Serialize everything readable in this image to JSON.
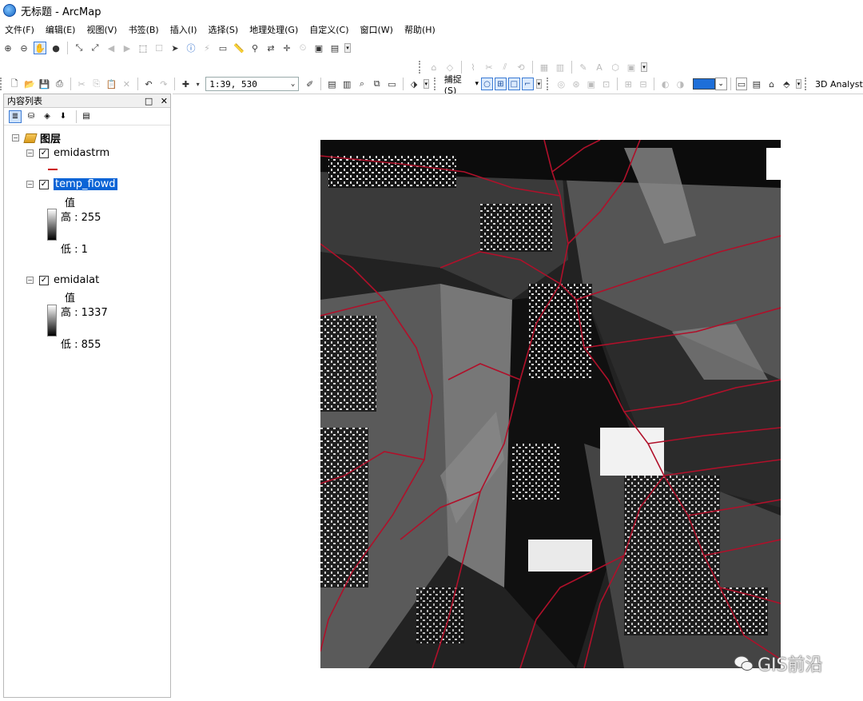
{
  "window": {
    "title": "无标题 - ArcMap"
  },
  "menu": [
    "文件(F)",
    "编辑(E)",
    "视图(V)",
    "书签(B)",
    "插入(I)",
    "选择(S)",
    "地理处理(G)",
    "自定义(C)",
    "窗口(W)",
    "帮助(H)"
  ],
  "toolbar": {
    "scale_value": "1:39, 530",
    "snap_label": "捕捉(S)",
    "snap_dropdown": "▾",
    "analyst_label": "3D Analyst"
  },
  "toc": {
    "title": "内容列表",
    "pin_icon": "□",
    "close_icon": "✕",
    "root_label": "图层",
    "layers": [
      {
        "name": "emidastrm",
        "checked": "☑"
      },
      {
        "name": "temp_flowd",
        "value_label": "值",
        "high_label": "高 : 255",
        "low_label": "低 : 1"
      },
      {
        "name": "emidalat",
        "value_label": "值",
        "high_label": "高 : 1337",
        "low_label": "低 : 855"
      }
    ]
  },
  "watermark": {
    "text": "GIS前沿"
  },
  "colors": {
    "selection": "#0a64d6",
    "stream": "#b0102a",
    "snap_active": "#3b7bd4"
  }
}
